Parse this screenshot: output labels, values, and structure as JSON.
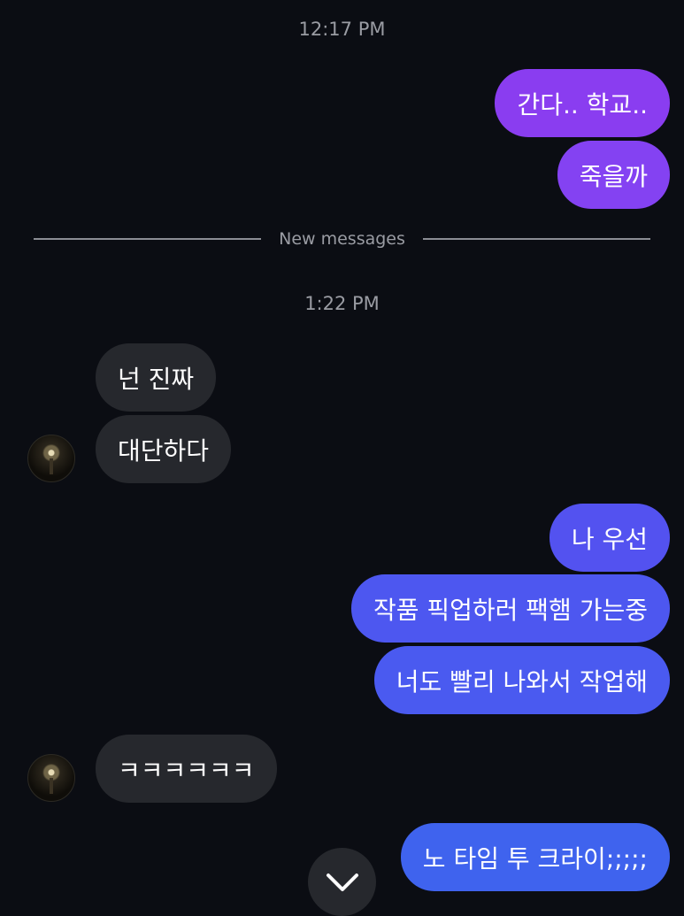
{
  "timestamps": [
    "12:17 PM",
    "1:22 PM"
  ],
  "divider_label": "New messages",
  "messages": [
    {
      "text": "간다.. 학교..",
      "dir": "out"
    },
    {
      "text": "죽을까",
      "dir": "out"
    },
    {
      "text": "넌 진짜",
      "dir": "in"
    },
    {
      "text": "대단하다",
      "dir": "in"
    },
    {
      "text": "나 우선",
      "dir": "out"
    },
    {
      "text": "작품 픽업하러 팩햄 가는중",
      "dir": "out"
    },
    {
      "text": "너도 빨리 나와서 작업해",
      "dir": "out"
    },
    {
      "text": "ㅋㅋㅋㅋㅋㅋ",
      "dir": "in"
    },
    {
      "text": "노 타임 투 크라이;;;;;",
      "dir": "out"
    }
  ],
  "colors": {
    "background": "#0b0d13",
    "incoming_bubble": "#26282d",
    "outgoing_purple": "#8a3df0",
    "outgoing_blue": "#4a5af0"
  },
  "icons": {
    "scroll_down": "chevron-down-icon"
  }
}
